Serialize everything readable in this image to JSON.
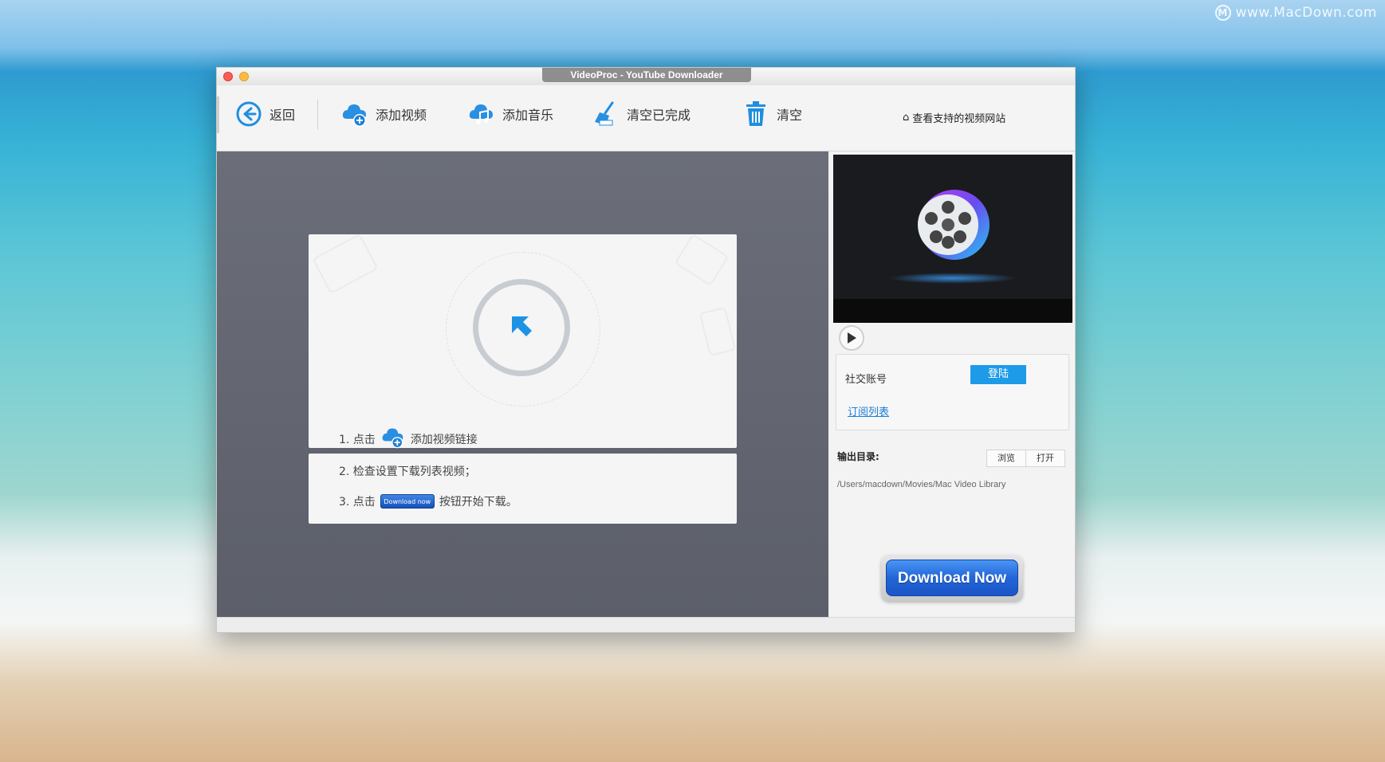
{
  "watermark": {
    "text": "www.MacDown.com",
    "logo": "M"
  },
  "window": {
    "title": "VideoProc - YouTube Downloader"
  },
  "toolbar": {
    "back_label": "返回",
    "add_video_label": "添加视频",
    "add_music_label": "添加音乐",
    "clear_done_label": "清空已完成",
    "clear_label": "清空",
    "supported_sites_label": "查看支持的视频网站"
  },
  "guide": {
    "step1_prefix": "1. 点击",
    "step1_suffix": "添加视频链接",
    "step2": "2. 检查设置下载列表视频；",
    "step3_prefix": "3. 点击",
    "step3_button": "Download now",
    "step3_suffix": "按钮开始下载。"
  },
  "sidebar": {
    "social_label": "社交账号",
    "login_label": "登陆",
    "subscription_link": "订阅列表",
    "output_label": "输出目录:",
    "browse_label": "浏览",
    "open_label": "打开",
    "output_path": "/Users/macdown/Movies/Mac Video Library",
    "download_now_label": "Download Now"
  },
  "colors": {
    "accent": "#1e9be8",
    "panel": "#63666f",
    "download_blue": "#2266d9"
  }
}
